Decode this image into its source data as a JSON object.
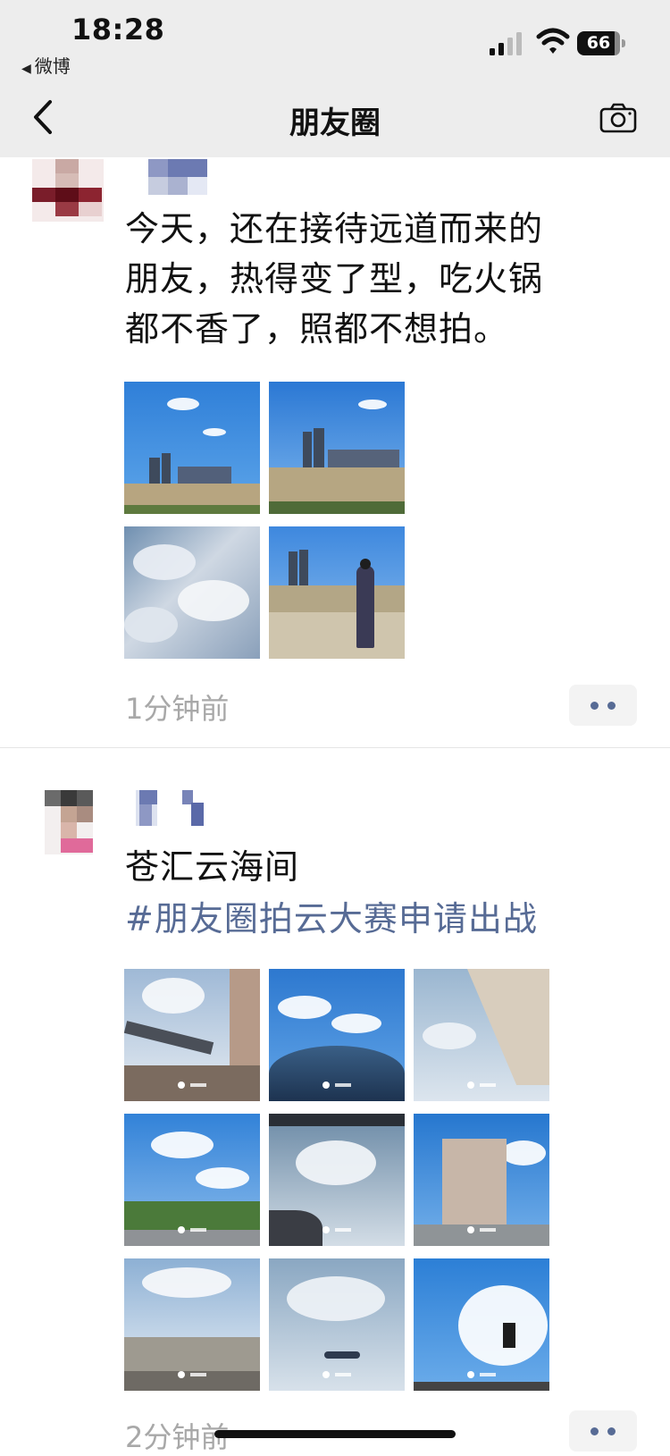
{
  "status_bar": {
    "time": "18:28",
    "back_app_label": "微博",
    "battery_level": "66"
  },
  "nav": {
    "title": "朋友圈",
    "back_icon": "chevron-left-icon",
    "camera_icon": "camera-icon"
  },
  "posts": [
    {
      "text_lines": [
        "今天，还在接待远道而来的",
        "朋友，热得变了型，吃火锅",
        "都不香了，照都不想拍。"
      ],
      "photos": [
        "skyline-river",
        "skyline-river-2",
        "cloudy-sky",
        "person-riverside"
      ],
      "time_ago": "1分钟前",
      "more_icon": "more-dots-icon"
    },
    {
      "text_lines": [
        "苍汇云海间"
      ],
      "hashtag": "#朋友圈拍云大赛申请出战",
      "photos": [
        "monorail-clouds",
        "car-roof-clouds",
        "canopy-clouds",
        "avenue-clouds",
        "car-window-clouds",
        "hotel-building",
        "gate-clouds",
        "airplane-clouds",
        "traffic-light-clouds"
      ],
      "time_ago": "2分钟前",
      "more_icon": "more-dots-icon"
    }
  ],
  "colors": {
    "link_blue": "#576b95",
    "bar_gray": "#ededed",
    "time_gray": "#a8a8a8"
  }
}
